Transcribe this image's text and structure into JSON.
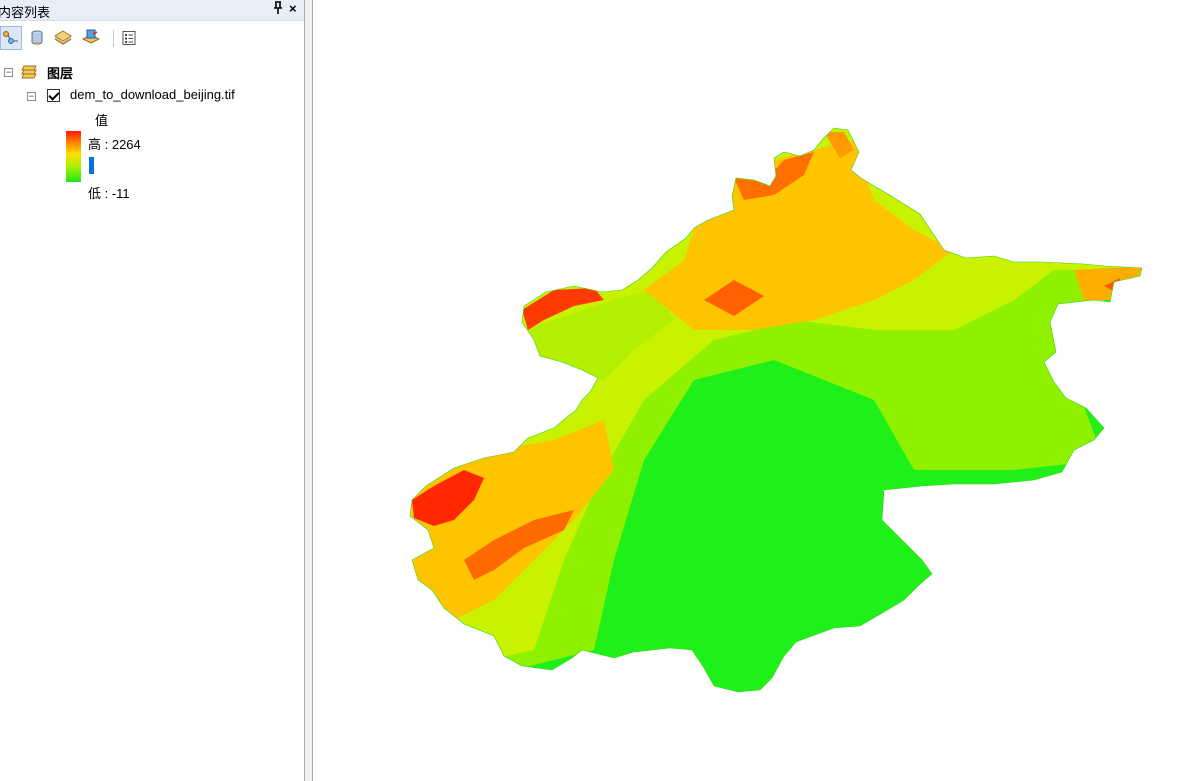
{
  "toc": {
    "title": "内容列表",
    "pin_glyph": "ᵖ",
    "close_glyph": "×",
    "toolbar": [
      {
        "name": "list-by-drawing-order-icon",
        "active": true
      },
      {
        "name": "list-by-source-icon",
        "active": false
      },
      {
        "name": "list-by-visibility-icon",
        "active": false
      },
      {
        "name": "list-by-selection-icon",
        "active": false
      },
      {
        "name": "options-icon",
        "active": false
      }
    ],
    "tree": {
      "group_expander": "⊟",
      "group_label": "图层",
      "layer_expander": "⊟",
      "layer_name": "dem_to_download_beijing.tif",
      "layer_checked": true,
      "legend": {
        "field": "值",
        "high_label": "高 : 2264",
        "low_label": "低 : -11",
        "colors": [
          "#ff1a00",
          "#ff7a00",
          "#ffe000",
          "#a8f000",
          "#1ce81a"
        ]
      }
    }
  },
  "map": {
    "layer": "dem_to_download_beijing.tif",
    "elevation_high": 2264,
    "elevation_low": -11,
    "colors": {
      "lowland": "#1ff01a",
      "hills": "#7cf000",
      "foothills": "#d8f000",
      "mountain": "#ffb000",
      "peak": "#ff2a00"
    }
  }
}
